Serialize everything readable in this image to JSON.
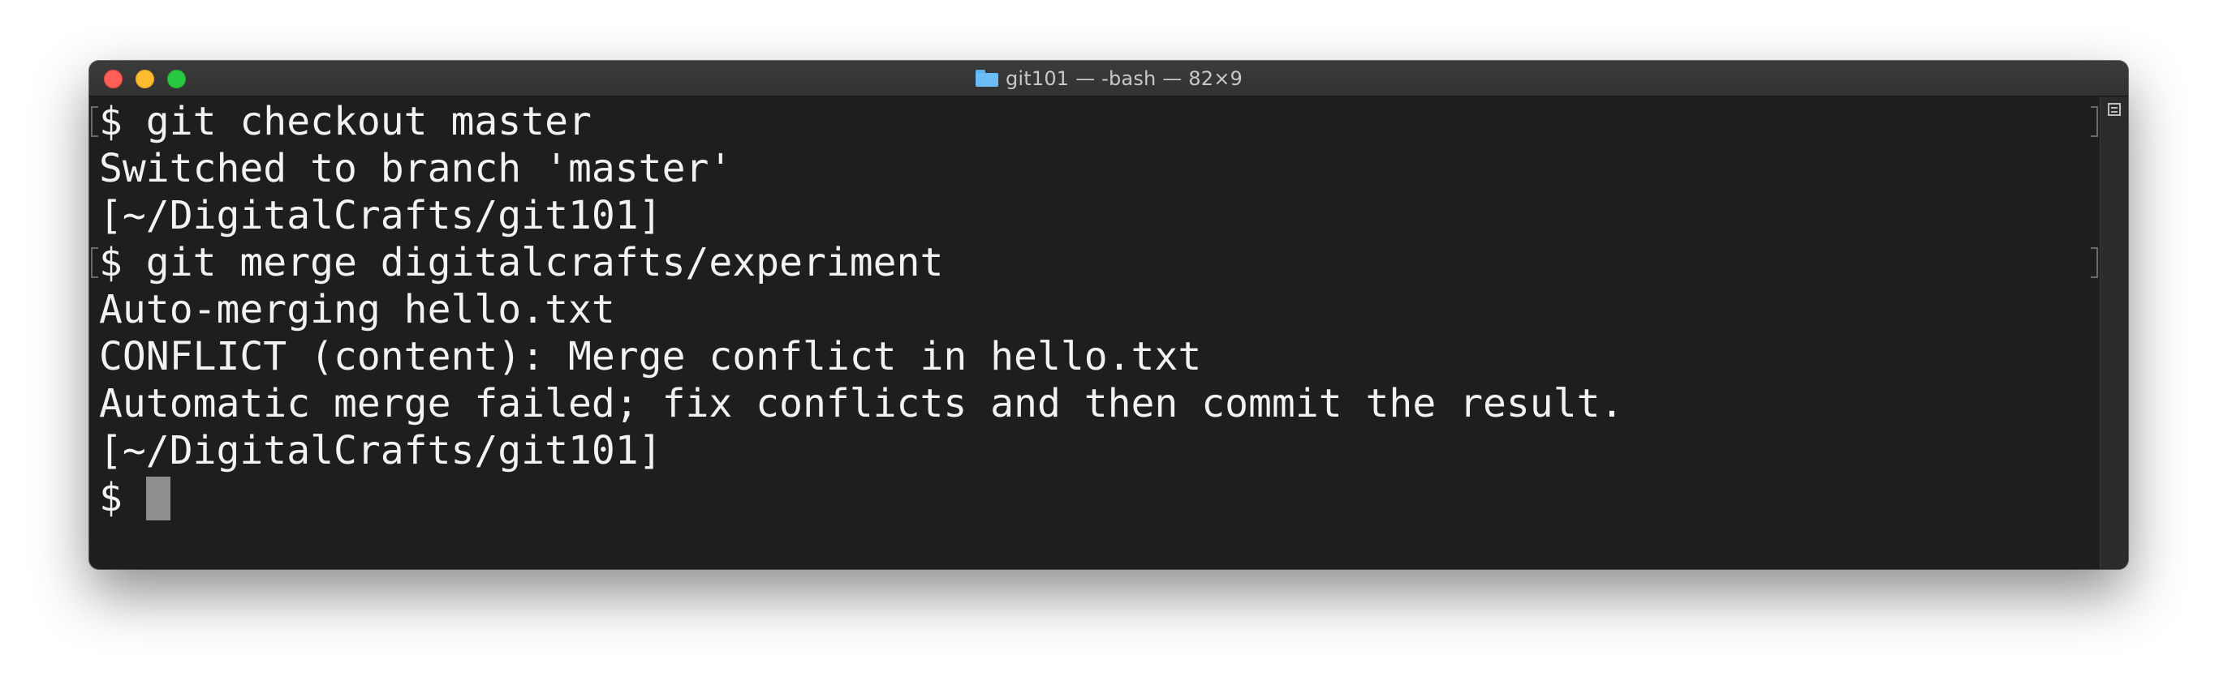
{
  "window": {
    "title": "git101 — -bash — 82×9"
  },
  "icons": {
    "title_icon": "folder-icon",
    "split_icon": "split-pane-icon"
  },
  "colors": {
    "terminal_bg": "#1e1e1e",
    "text": "#f2f2f2",
    "close": "#ff5f57",
    "minimize": "#febc2e",
    "zoom": "#28c840",
    "cursor": "#8e8e8e"
  },
  "terminal": {
    "lines": [
      "$ git checkout master",
      "Switched to branch 'master'",
      "[~/DigitalCrafts/git101]",
      "$ git merge digitalcrafts/experiment",
      "Auto-merging hello.txt",
      "CONFLICT (content): Merge conflict in hello.txt",
      "Automatic merge failed; fix conflicts and then commit the result.",
      "[~/DigitalCrafts/git101]"
    ],
    "prompt": "$ "
  }
}
